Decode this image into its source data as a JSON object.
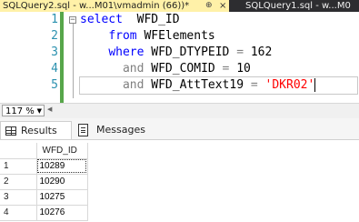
{
  "tabs": {
    "active": {
      "label": "SQLQuery2.sql - w...M01\\vmadmin (66))*",
      "pin": "⊕",
      "close": "×"
    },
    "inactive": {
      "label": "SQLQuery1.sql - w...M0"
    }
  },
  "editor": {
    "line_numbers": [
      "1",
      "2",
      "3",
      "4",
      "5"
    ],
    "fold_glyph": "−",
    "lines": [
      {
        "kw1": "select",
        "text1": "  WFD_ID"
      },
      {
        "indent": "    ",
        "kw1": "from",
        "text1": " WFElements"
      },
      {
        "indent": "    ",
        "kw1": "where",
        "text1": " WFD_DTYPEID ",
        "op": "=",
        "text2": " 162"
      },
      {
        "indent": "      ",
        "kw1": "and",
        "text1": " WFD_COMID ",
        "op": "=",
        "text2": " 10"
      },
      {
        "indent": "      ",
        "kw1": "and",
        "text1": " WFD_AttText19 ",
        "op": "=",
        "str": "'DKR02'"
      }
    ]
  },
  "zoom": {
    "value": "117 %"
  },
  "result_tabs": {
    "results": "Results",
    "messages": "Messages"
  },
  "grid": {
    "header": "WFD_ID",
    "rows": [
      {
        "num": "1",
        "value": "10289"
      },
      {
        "num": "2",
        "value": "10290"
      },
      {
        "num": "3",
        "value": "10275"
      },
      {
        "num": "4",
        "value": "10276"
      }
    ]
  }
}
